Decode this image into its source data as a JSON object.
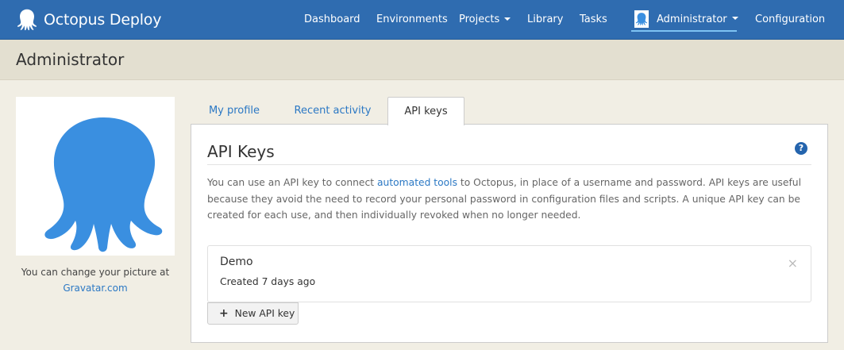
{
  "app": {
    "brand": "Octopus Deploy"
  },
  "colors": {
    "navbar": "#2f6cb0",
    "accent": "#2b78c4",
    "octopus": "#3a8fe0",
    "background": "#f1eee4"
  },
  "nav": {
    "dashboard": "Dashboard",
    "environments": "Environments",
    "projects": "Projects",
    "library": "Library",
    "tasks": "Tasks",
    "user": "Administrator",
    "configuration": "Configuration"
  },
  "page": {
    "title": "Administrator"
  },
  "avatar": {
    "caption": "You can change your picture at",
    "link": "Gravatar.com",
    "icon": "octopus-icon"
  },
  "tabs": [
    {
      "label": "My profile",
      "active": false
    },
    {
      "label": "Recent activity",
      "active": false
    },
    {
      "label": "API keys",
      "active": true
    }
  ],
  "panel": {
    "title": "API Keys",
    "help_icon": "?",
    "description_before": "You can use an API key to connect ",
    "description_link": "automated tools",
    "description_after": " to Octopus, in place of a username and password. API keys are useful because they avoid the need to record your personal password in configuration files and scripts. A unique API key can be created for each use, and then individually revoked when no longer needed.",
    "keys": [
      {
        "name": "Demo",
        "created": "Created 7 days ago",
        "close": "×"
      }
    ],
    "new_key_label": "New API key",
    "new_key_icon": "+"
  }
}
